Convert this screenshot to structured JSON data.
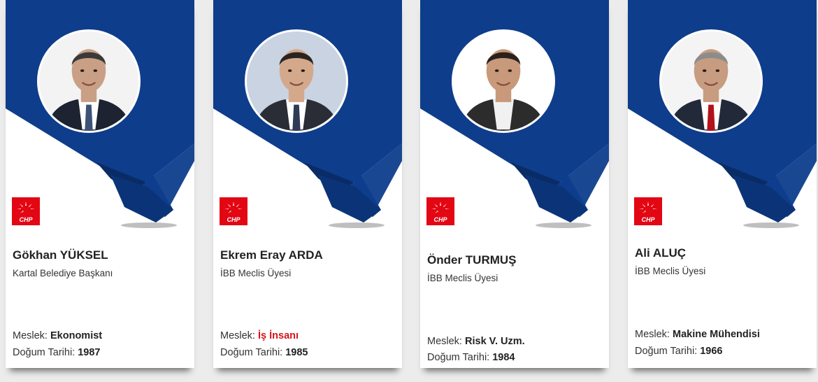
{
  "colors": {
    "banner": "#0e3d8c",
    "banner_dark": "#0a2c66",
    "logo_red": "#e30613",
    "highlight_red": "#d8141e"
  },
  "logo_text": "CHP",
  "cards": [
    {
      "name": "Gökhan YÜKSEL",
      "role": "Kartal Belediye Başkanı",
      "profession_label": "Meslek:",
      "profession": "Ekonomist",
      "birth_label": "Doğum Tarihi:",
      "birth_year": "1987"
    },
    {
      "name": "Ekrem Eray ARDA",
      "role": "İBB Meclis Üyesi",
      "profession_label": "Meslek:",
      "profession": "İş İnsanı",
      "birth_label": "Doğum Tarihi:",
      "birth_year": "1985"
    },
    {
      "name": "Önder TURMUŞ",
      "role": "İBB Meclis Üyesi",
      "profession_label": "Meslek:",
      "profession": "Risk V. Uzm.",
      "birth_label": "Doğum Tarihi:",
      "birth_year": "1984"
    },
    {
      "name": "Ali ALUÇ",
      "role": "İBB Meclis Üyesi",
      "profession_label": "Meslek:",
      "profession": "Makine Mühendisi",
      "birth_label": "Doğum Tarihi:",
      "birth_year": "1966"
    }
  ]
}
